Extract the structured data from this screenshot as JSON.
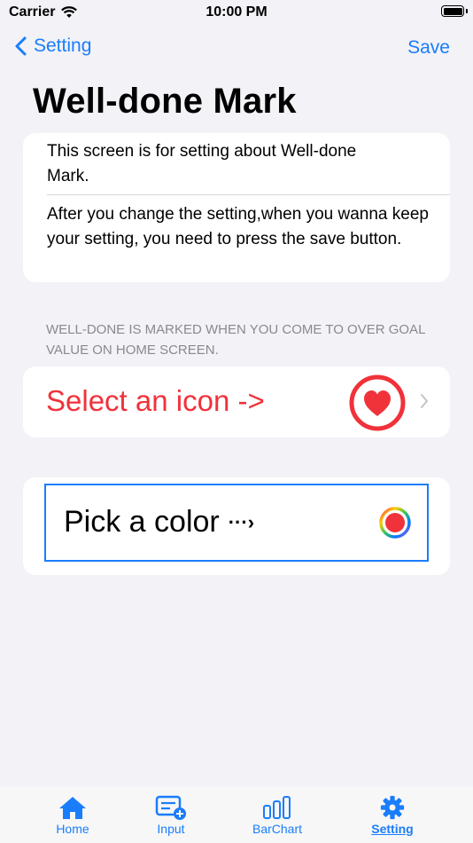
{
  "status_bar": {
    "carrier": "Carrier",
    "time": "10:00 PM"
  },
  "nav": {
    "back_label": "Setting",
    "save_label": "Save"
  },
  "page": {
    "title": "Well-done Mark"
  },
  "info": {
    "line1": "This screen is for setting about Well-done Mark.",
    "line2": "After you change the setting,when you wanna keep your setting, you need to press the save button."
  },
  "section_note": "WELL-DONE IS MARKED WHEN YOU COME TO OVER GOAL VALUE ON HOME SCREEN.",
  "icon_row": {
    "label": "Select an icon ->",
    "selected_icon": "heart-icon",
    "accent_color": "#f0323b"
  },
  "color_row": {
    "label": "Pick a color",
    "arrow_glyph": "···›",
    "selected_color": "#f0323b"
  },
  "tabs": [
    {
      "label": "Home",
      "icon": "house-icon"
    },
    {
      "label": "Input",
      "icon": "input-icon"
    },
    {
      "label": "BarChart",
      "icon": "bar-chart-icon"
    },
    {
      "label": "Setting",
      "icon": "gear-icon",
      "active": true
    }
  ],
  "colors": {
    "accent": "#1a7dfb",
    "background": "#f2f2f7"
  }
}
